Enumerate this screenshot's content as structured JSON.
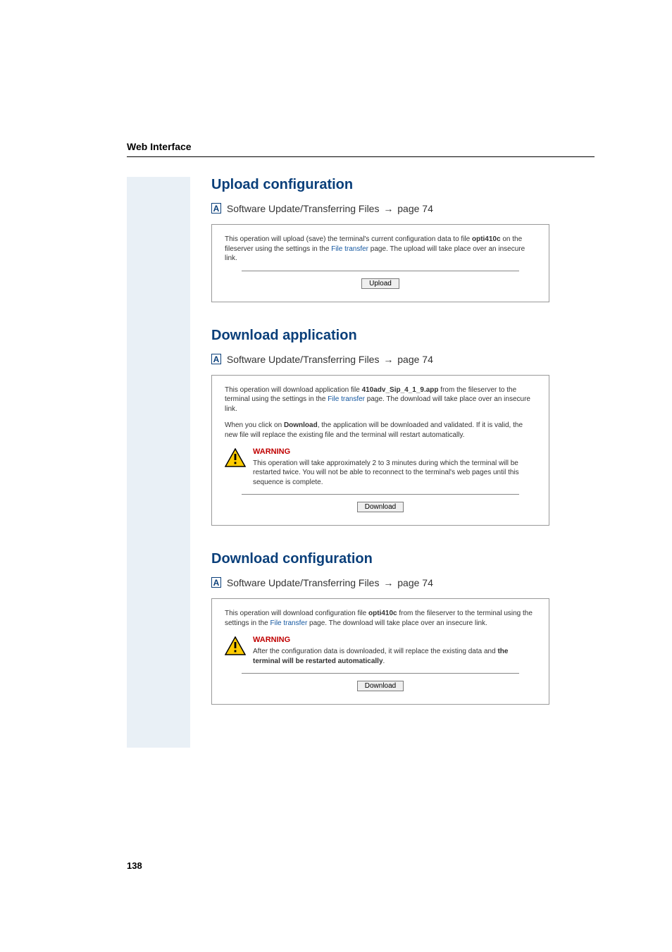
{
  "header": {
    "title": "Web Interface"
  },
  "page_number": "138",
  "refs": {
    "boxLetter": "A",
    "text_prefix": "Software Update/Transferring Files",
    "arrow": "→",
    "page_label": "page 74"
  },
  "sections": {
    "upload": {
      "title": "Upload configuration",
      "panel": {
        "desc_a": "This operation will upload (save) the terminal's current configuration data to file ",
        "filename": "opti410c",
        "desc_b": " on the fileserver using the settings in the ",
        "link_text": "File transfer",
        "desc_c": " page. The upload will take place over an insecure link.",
        "button": "Upload"
      }
    },
    "download_app": {
      "title": "Download application",
      "panel": {
        "p1_a": "This operation will download application file ",
        "p1_file": "410adv_Sip_4_1_9.app",
        "p1_b": " from the fileserver to the terminal using the settings in the ",
        "p1_link": "File transfer",
        "p1_c": " page. The download will take place over an insecure link.",
        "p2_a": "When you click on ",
        "p2_bold": "Download",
        "p2_b": ", the application will be downloaded and validated. If it is valid, the new file will replace the existing file and the terminal will restart automatically.",
        "warn_title": "WARNING",
        "warn_text": "This operation will take approximately 2 to 3 minutes during which the terminal will be restarted twice. You will not be able to reconnect to the terminal's web pages until this sequence is complete.",
        "button": "Download"
      }
    },
    "download_cfg": {
      "title": "Download configuration",
      "panel": {
        "p1_a": "This operation will download configuration file ",
        "p1_file": "opti410c",
        "p1_b": " from the fileserver to the terminal using the settings in the ",
        "p1_link": "File transfer",
        "p1_c": " page. The download will take place over an insecure link.",
        "warn_title": "WARNING",
        "warn_a": "After the configuration data is downloaded, it will replace the existing data and ",
        "warn_bold": "the terminal will be restarted automatically",
        "warn_b": ".",
        "button": "Download"
      }
    }
  }
}
